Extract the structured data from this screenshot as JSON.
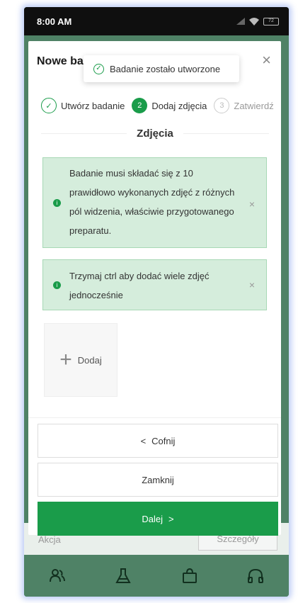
{
  "status_bar": {
    "time": "8:00 AM",
    "battery": "72"
  },
  "dialog": {
    "title": "Nowe badanie",
    "steps": [
      {
        "number": "1",
        "label": "Utwórz badanie",
        "state": "done"
      },
      {
        "number": "2",
        "label": "Dodaj zdjęcia",
        "state": "active"
      },
      {
        "number": "3",
        "label": "Zatwierdź",
        "state": "pending"
      }
    ],
    "section_title": "Zdjęcia",
    "alerts": [
      {
        "text": "Badanie musi składać się z 10 prawidłowo wykonanych zdjęć z różnych pól widzenia, właściwie przygotowanego preparatu."
      },
      {
        "text": "Trzymaj ctrl aby dodać wiele zdjęć jednocześnie"
      }
    ],
    "upload_label": "Dodaj",
    "buttons": {
      "back": "Cofnij",
      "close": "Zamknij",
      "next": "Dalej"
    }
  },
  "toast": {
    "message": "Badanie zostało utworzone"
  },
  "background": {
    "left_text": "Akcja",
    "details_button": "Szczegóły"
  },
  "colors": {
    "accent": "#1a9c4a",
    "alert_bg": "#d5eddc",
    "nav_bg": "#4f8266"
  },
  "bottom_nav": [
    "people-icon",
    "flask-icon",
    "bag-icon",
    "headphones-icon"
  ]
}
